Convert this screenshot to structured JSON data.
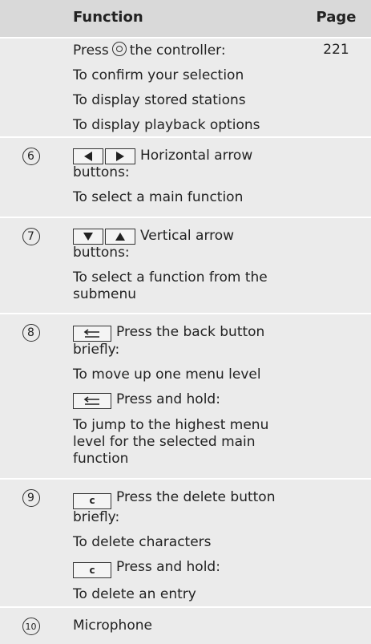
{
  "header": {
    "function_label": "Function",
    "page_label": "Page"
  },
  "row_controller": {
    "press_prefix": "Press",
    "press_suffix": "the controller:",
    "lines": [
      "To confirm your selection",
      "To display stored stations",
      "To display playback options"
    ],
    "page": "221"
  },
  "row_6": {
    "number": "6",
    "title_line1": "Horizontal arrow",
    "title_line2": "buttons:",
    "line": "To select a main function"
  },
  "row_7": {
    "number": "7",
    "title_line1": "Vertical arrow",
    "title_line2": "buttons:",
    "line1": "To select a function from the",
    "line2": "submenu"
  },
  "row_8": {
    "number": "8",
    "press_brief_line1": "Press the back button",
    "press_brief_line2": "briefly:",
    "brief_result": "To move up one menu level",
    "press_hold": "Press and hold:",
    "hold_line1": "To jump to the highest menu",
    "hold_line2": "level for the selected main",
    "hold_line3": "function"
  },
  "row_9": {
    "number": "9",
    "key_label": "c",
    "press_brief_line1": "Press the delete button",
    "press_brief_line2": "briefly:",
    "brief_result": "To delete characters",
    "press_hold": "Press and hold:",
    "hold_result": "To delete an entry"
  },
  "row_10": {
    "number": "10",
    "label": "Microphone"
  }
}
